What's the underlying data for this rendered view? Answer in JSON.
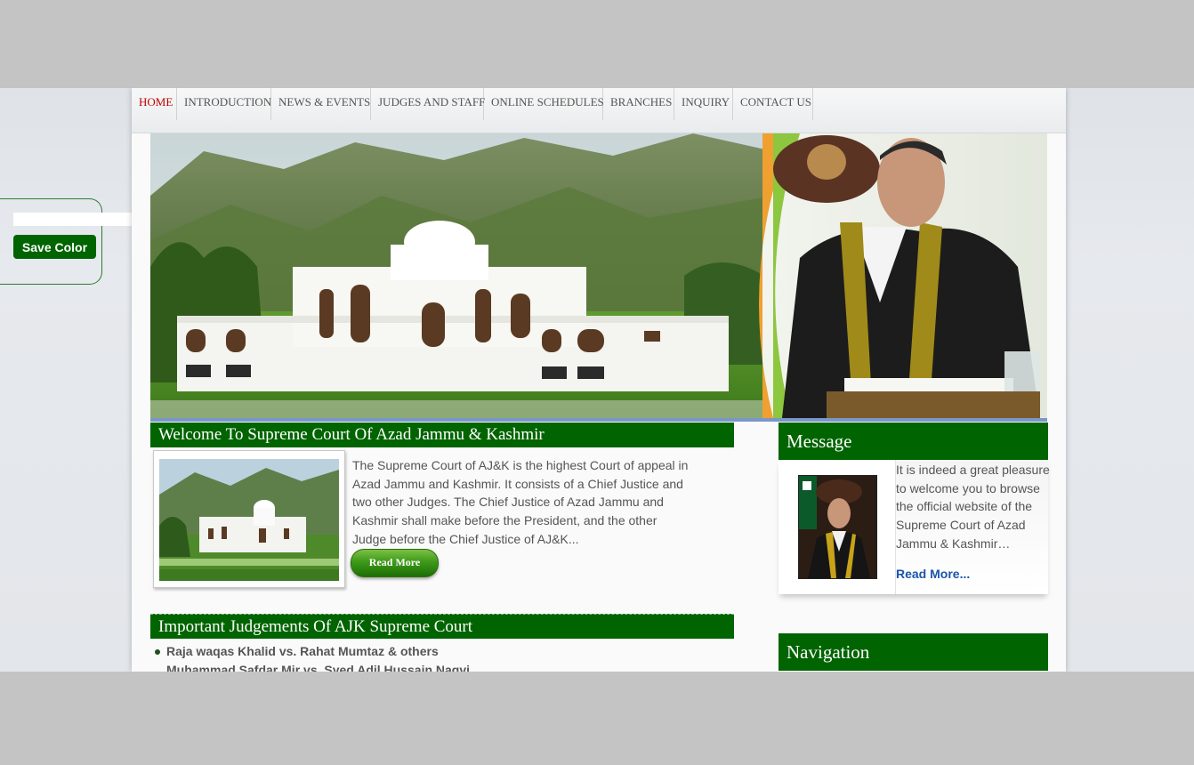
{
  "color_widget": {
    "input_value": "",
    "save_label": "Save Color"
  },
  "nav": {
    "items": [
      {
        "label": "HOME",
        "active": true
      },
      {
        "label": "INTRODUCTION"
      },
      {
        "label": "NEWS & EVENTS"
      },
      {
        "label": "JUDGES AND STAFF"
      },
      {
        "label": "ONLINE SCHEDULES"
      },
      {
        "label": "BRANCHES"
      },
      {
        "label": "INQUIRY"
      },
      {
        "label": "CONTACT US"
      }
    ]
  },
  "welcome": {
    "title": "Welcome To Supreme Court Of Azad Jammu & Kashmir",
    "text": "The Supreme Court of AJ&K is the highest Court of appeal in Azad Jammu and Kashmir. It consists of a Chief Justice and two other Judges. The Chief Justice of Azad Jammu and Kashmir shall make before the President, and the other Judge before the Chief Justice of AJ&K...",
    "read_more": "Read More"
  },
  "judgements": {
    "title": "Important Judgements Of AJK Supreme Court",
    "items": [
      "Raja waqas Khalid vs. Rahat Mumtaz & others",
      "Muhammad Safdar Mir vs. Syed Adil Hussain Naqvi"
    ]
  },
  "message": {
    "title": "Message",
    "text": "It is indeed a great pleasure to welcome you to browse the official website of the Supreme Court of Azad Jammu & Kashmir…",
    "read_more": "Read More..."
  },
  "navigation": {
    "title": "Navigation"
  },
  "colors": {
    "brand_green": "#006400",
    "nav_active": "#c00000",
    "link_blue": "#1a55a8",
    "banner_stripe": "#7b96c9"
  },
  "images": {
    "banner": "court-building-and-chief-justice-banner",
    "welcome_photo": "court-building-photo",
    "message_photo": "chief-justice-portrait"
  }
}
